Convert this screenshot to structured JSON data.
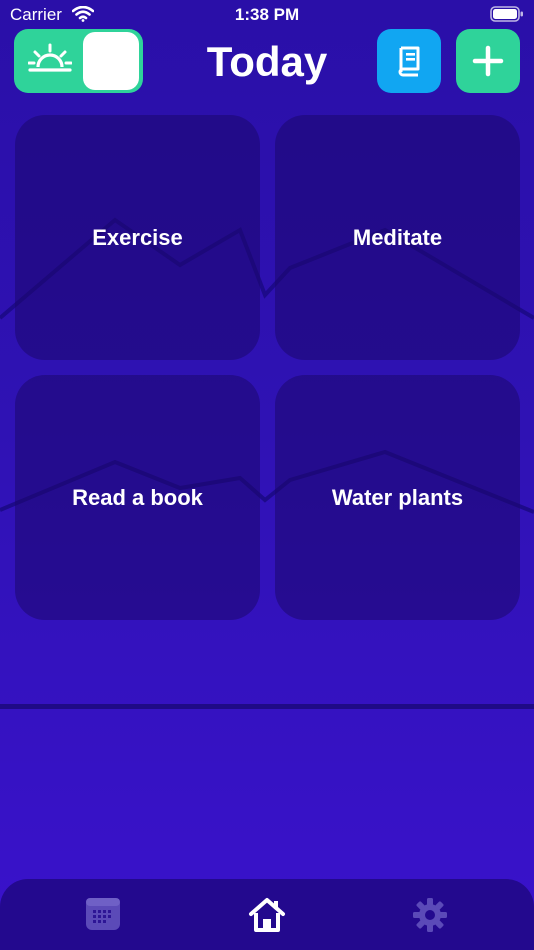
{
  "status_bar": {
    "carrier": "Carrier",
    "time": "1:38 PM"
  },
  "header": {
    "title": "Today"
  },
  "habits": [
    {
      "label": "Exercise"
    },
    {
      "label": "Meditate"
    },
    {
      "label": "Read a book"
    },
    {
      "label": "Water plants"
    }
  ],
  "colors": {
    "background": "#2f12b4",
    "accent_green": "#2fd39a",
    "accent_blue": "#11a6f2",
    "card": "#1c086e",
    "tabbar": "#23098e"
  },
  "icons": {
    "toggle": "sunrise-icon",
    "journal": "book-icon",
    "add": "plus-icon",
    "tabs": [
      "calendar-icon",
      "home-icon",
      "gear-icon"
    ]
  }
}
